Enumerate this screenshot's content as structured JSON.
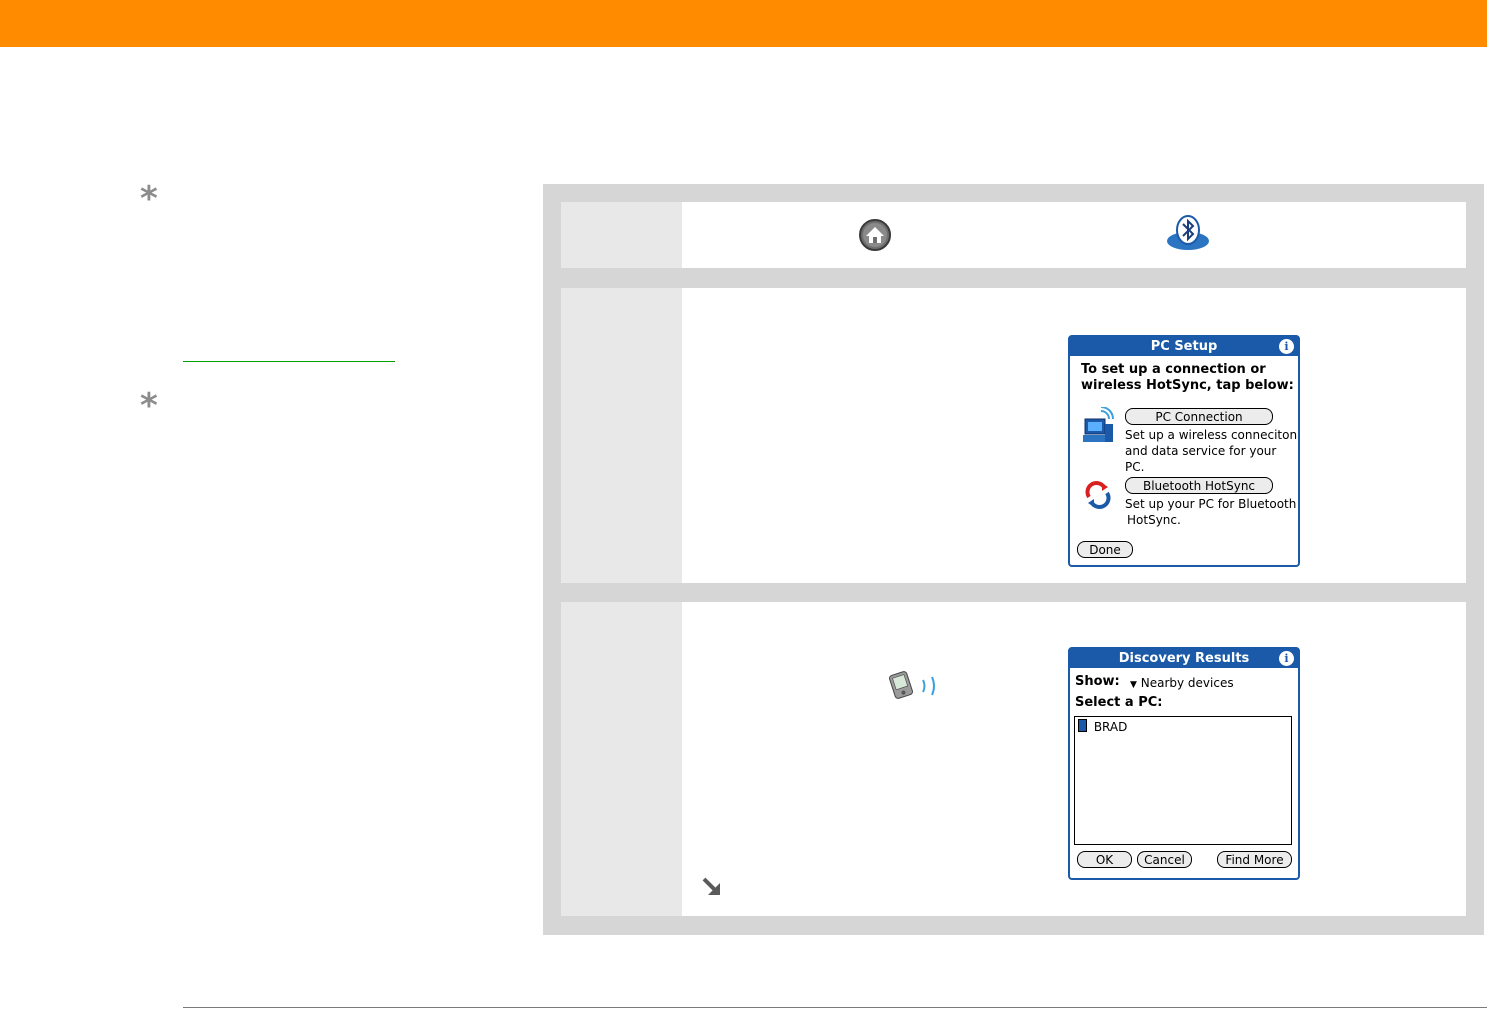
{
  "header": {
    "color": "#ff8c00"
  },
  "sidebar": {
    "tip_icon": "asterisk-icon",
    "link_color": "#00a000"
  },
  "steps": [
    {
      "icons": [
        "home-icon",
        "bluetooth-icon"
      ]
    },
    {
      "dialog": {
        "title": "PC Setup",
        "intro_line1": "To set up a connection or",
        "intro_line2": "wireless HotSync, tap below:",
        "options": [
          {
            "button": "PC Connection",
            "desc": [
              "Set up a wireless conneciton",
              "and data service for your",
              "PC."
            ]
          },
          {
            "button": "Bluetooth HotSync",
            "desc": [
              "Set up your PC for Bluetooth",
              "HotSync."
            ]
          }
        ],
        "done": "Done"
      }
    },
    {
      "icons": [
        "handheld-beaming-icon",
        "continue-arrow-icon"
      ],
      "dialog": {
        "title": "Discovery Results",
        "show_label": "Show:",
        "show_value": "Nearby devices",
        "select_label": "Select a PC:",
        "items": [
          "BRAD"
        ],
        "buttons": {
          "ok": "OK",
          "cancel": "Cancel",
          "find_more": "Find More"
        }
      }
    }
  ]
}
